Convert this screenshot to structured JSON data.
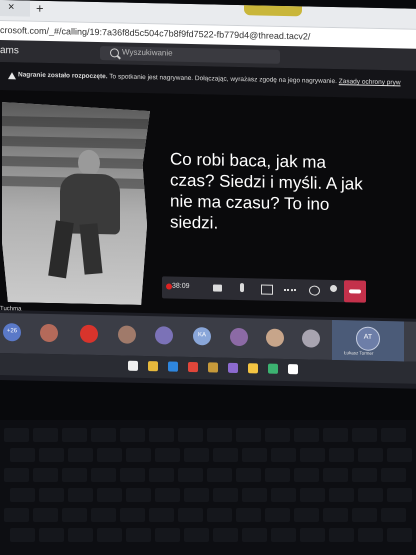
{
  "browser": {
    "tab_close": "×",
    "tab_new": "+",
    "url": "crosoft.com/_#/calling/19:7a36f8d5c504c7b8f9fd7522-fb779d4@thread.tacv2/"
  },
  "teams": {
    "app_name": "ams",
    "search_placeholder": "Wyszukiwanie"
  },
  "notice": {
    "icon": "warning-icon",
    "bold": "Nagranie zostało rozpoczęte.",
    "text": "To spotkanie jest nagrywane. Dołączając, wyrażasz zgodę na jego nagrywanie.",
    "link": "Zasady ochrony pryw"
  },
  "slide": {
    "text": "Co robi baca, jak ma czas? Siedzi i myśli. A jak nie ma czasu? To ino siedzi."
  },
  "controls": {
    "timer": "38:09",
    "items": [
      "video-icon",
      "mic-off-icon",
      "share-icon",
      "more-icon",
      "chat-icon",
      "people-icon",
      "hangup-icon"
    ]
  },
  "presenter_label": "Tuchma",
  "participants": [
    {
      "initials": "+26",
      "color": "#5a79c8"
    },
    {
      "initials": "",
      "color": "#b46a5a"
    },
    {
      "initials": "",
      "color": "#d8342c"
    },
    {
      "initials": "",
      "color": "#a07a6a"
    },
    {
      "initials": "",
      "color": "#7b72b7"
    },
    {
      "initials": "KA",
      "color": "#89a6d9"
    },
    {
      "initials": "",
      "color": "#8c6aa5"
    },
    {
      "initials": "",
      "color": "#c7a58a"
    },
    {
      "initials": "",
      "color": "#a8a4b0"
    }
  ],
  "self": {
    "initials": "AT",
    "name": "Łukasz Tor­mer"
  },
  "taskbar": {
    "icons": [
      "#f0f0f0",
      "#e7b93c",
      "#2e86de",
      "#e0463a",
      "#c79a3a",
      "#8c6ad0",
      "#f4c542",
      "#3cb371",
      "#ffffff"
    ]
  }
}
